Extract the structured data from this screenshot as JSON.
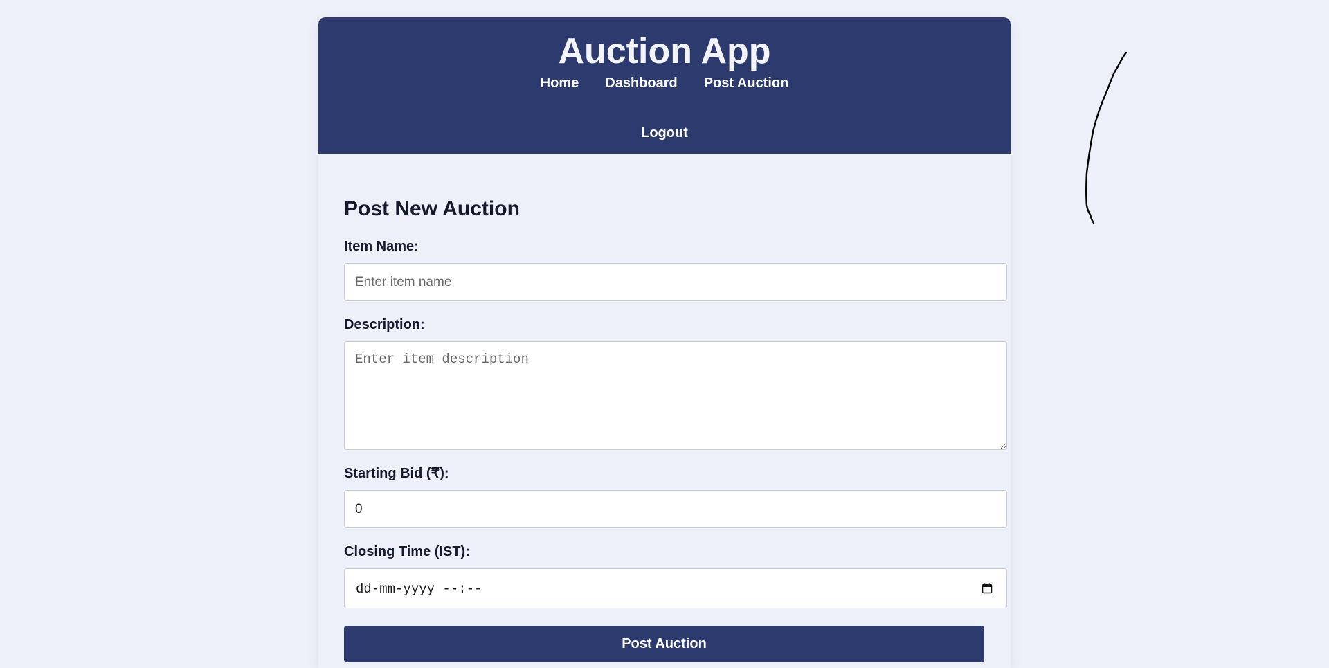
{
  "header": {
    "title": "Auction App",
    "nav": {
      "home": "Home",
      "dashboard": "Dashboard",
      "post_auction": "Post Auction",
      "logout": "Logout"
    }
  },
  "form": {
    "title": "Post New Auction",
    "item_name": {
      "label": "Item Name:",
      "placeholder": "Enter item name",
      "value": ""
    },
    "description": {
      "label": "Description:",
      "placeholder": "Enter item description",
      "value": ""
    },
    "starting_bid": {
      "label": "Starting Bid (₹):",
      "value": "0"
    },
    "closing_time": {
      "label": "Closing Time (IST):",
      "display_value": "dd-mm-yyyy --:--",
      "icon": "calendar-icon"
    },
    "submit_label": "Post Auction"
  },
  "colors": {
    "page_background": "#eef0f9",
    "header_background": "#2d3a6e",
    "button_background": "#2d3a6e",
    "input_border": "#c9cce2",
    "text": "#151a2e"
  }
}
